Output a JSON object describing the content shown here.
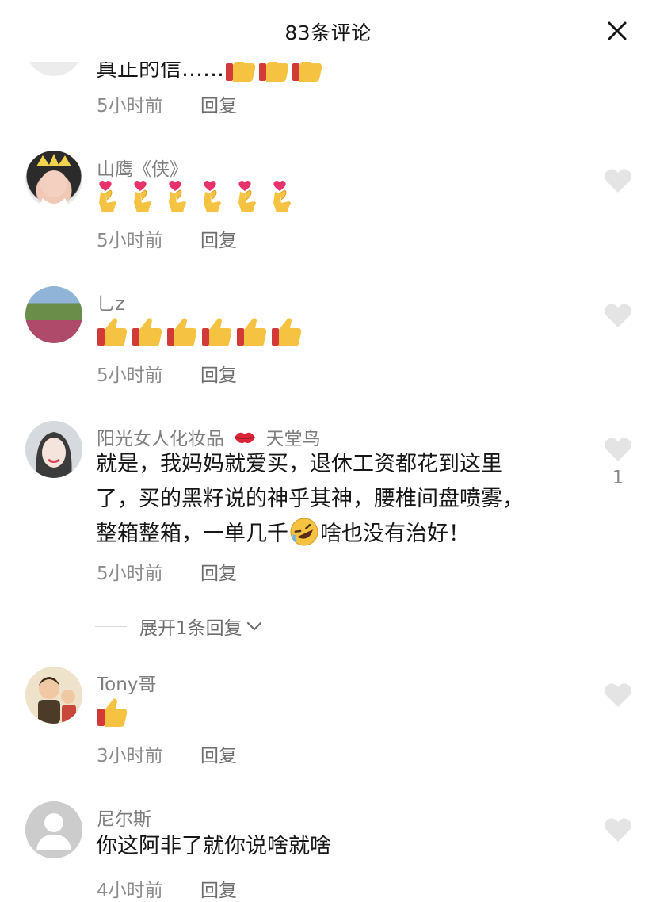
{
  "header": {
    "title": "83条评论",
    "close_icon": "close-icon"
  },
  "reply_label": "回复",
  "comments": [
    {
      "name": "",
      "text_partial": "真正的信……",
      "emoji": "thumbs-up-icon",
      "emoji_count": 3,
      "time": "5小时前"
    },
    {
      "name": "山鹰《侠》",
      "emoji": "finger-heart-icon",
      "emoji_count": 6,
      "time": "5小时前"
    },
    {
      "name": "乚z",
      "emoji": "thumbs-up-icon",
      "emoji_count": 6,
      "time": "5小时前"
    },
    {
      "name": "阳光女人化妆品",
      "name_suffix": "天堂鸟",
      "name_emoji": "kiss-mark-icon",
      "lines": [
        "就是，我妈妈就爱买，退休工资都花到这里",
        "了，买的黑籽说的神乎其神，腰椎间盘喷雾，",
        "整箱整箱，一单几千",
        "啥也没有治好！"
      ],
      "inline_emoji": "rolling-laughing-icon",
      "time": "5小时前",
      "likes": "1"
    },
    {
      "name": "Tony哥",
      "emoji": "thumbs-up-icon",
      "emoji_count": 1,
      "time": "3小时前"
    },
    {
      "name": "尼尔斯",
      "text": "你这阿非了就你说啥就啥",
      "time": "4小时前"
    }
  ],
  "expand_replies": "展开1条回复",
  "colors": {
    "text": "#161616",
    "muted": "#8b8b8b",
    "like": "#e4e4e4",
    "thumb": "#f6c242"
  }
}
